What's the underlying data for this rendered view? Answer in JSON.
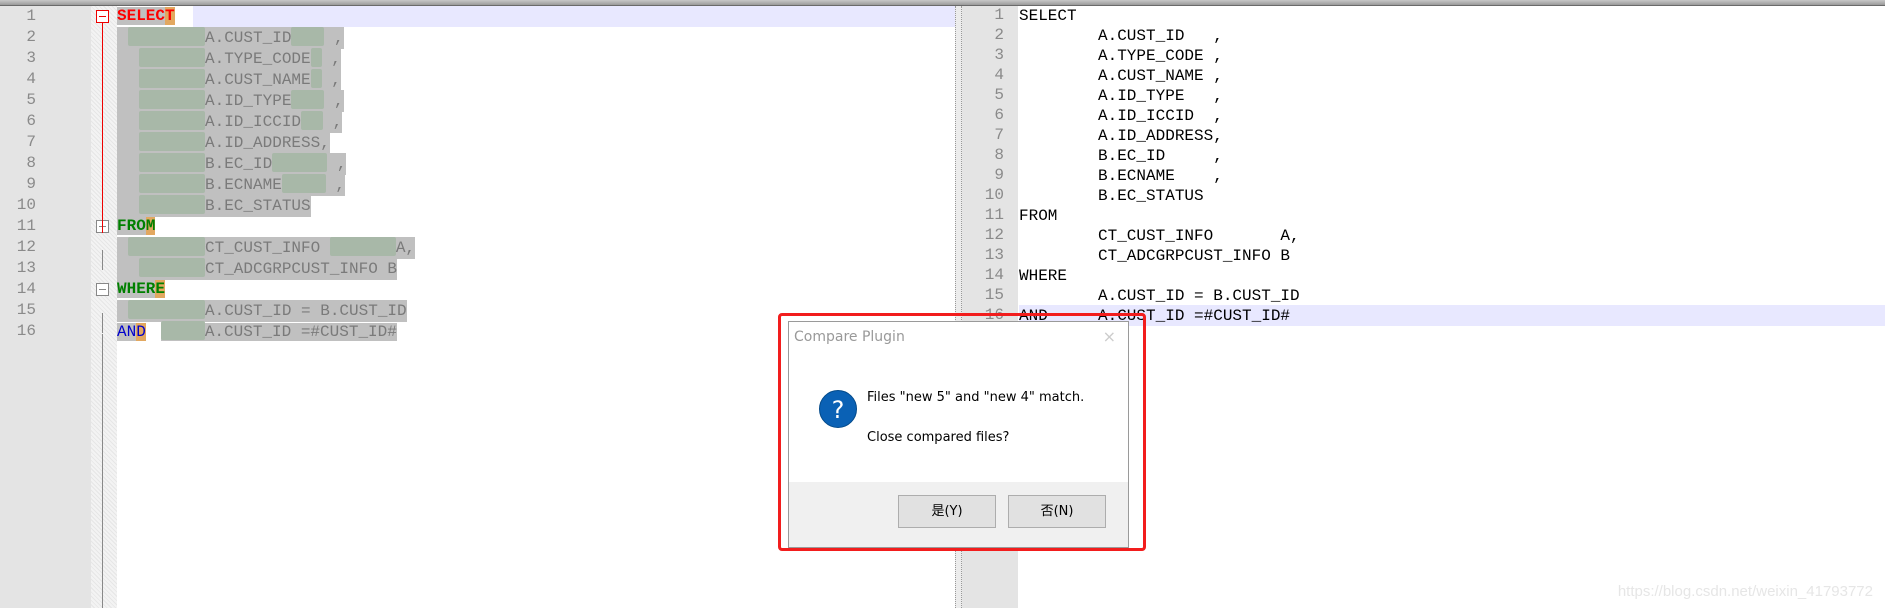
{
  "left_editor": {
    "current_line": 1,
    "lines": [
      {
        "n": "1",
        "kw": "SELECT",
        "kwclass": "kw-red",
        "text": ""
      },
      {
        "n": "2",
        "lead": [
          11,
          77
        ],
        "text": "A.CUST_ID",
        "trail": 33,
        "end": " ,"
      },
      {
        "n": "3",
        "lead": [
          22,
          66
        ],
        "text": "A.TYPE_CODE",
        "trail": 11,
        "end": " ,"
      },
      {
        "n": "4",
        "lead": [
          22,
          66
        ],
        "text": "A.CUST_NAME",
        "trail": 11,
        "end": " ,"
      },
      {
        "n": "5",
        "lead": [
          22,
          66
        ],
        "text": "A.ID_TYPE",
        "trail": 33,
        "end": " ,"
      },
      {
        "n": "6",
        "lead": [
          22,
          66
        ],
        "text": "A.ID_ICCID",
        "trail": 22,
        "end": " ,"
      },
      {
        "n": "7",
        "lead": [
          22,
          66
        ],
        "text": "A.ID_ADDRESS,",
        "trail": 0,
        "end": ""
      },
      {
        "n": "8",
        "lead": [
          22,
          66
        ],
        "text": "B.EC_ID",
        "trail": 55,
        "end": " ,"
      },
      {
        "n": "9",
        "lead": [
          22,
          66
        ],
        "text": "B.ECNAME",
        "trail": 44,
        "end": " ,"
      },
      {
        "n": "10",
        "lead": [
          22,
          66
        ],
        "text": "B.EC_STATUS",
        "trail": 0,
        "end": ""
      },
      {
        "n": "11",
        "kw": "FROM",
        "kwclass": "kw-green",
        "text": ""
      },
      {
        "n": "12",
        "lead": [
          11,
          77
        ],
        "text": "CT_CUST_INFO ",
        "trail": 66,
        "end": "A,"
      },
      {
        "n": "13",
        "lead": [
          22,
          66
        ],
        "text": "CT_ADCGRPCUST_INFO B",
        "trail": 0,
        "end": ""
      },
      {
        "n": "14",
        "kw": "WHERE",
        "kwclass": "kw-green",
        "text": ""
      },
      {
        "n": "15",
        "lead": [
          11,
          77
        ],
        "text": "A.CUST_ID = B.CUST_ID",
        "trail": 0,
        "end": ""
      },
      {
        "n": "16",
        "kw": "AND",
        "kwclass": "kw-blue",
        "lead": [
          33,
          44
        ],
        "text": "A.CUST_ID =#CUST_ID#",
        "trail": 0,
        "end": ""
      }
    ]
  },
  "right_editor": {
    "current_line": 16,
    "lines": [
      {
        "n": "1",
        "a": "SELECT",
        "b": ""
      },
      {
        "n": "2",
        "a": "",
        "b": "A.CUST_ID   ,"
      },
      {
        "n": "3",
        "a": "",
        "b": "A.TYPE_CODE ,"
      },
      {
        "n": "4",
        "a": "",
        "b": "A.CUST_NAME ,"
      },
      {
        "n": "5",
        "a": "",
        "b": "A.ID_TYPE   ,"
      },
      {
        "n": "6",
        "a": "",
        "b": "A.ID_ICCID  ,"
      },
      {
        "n": "7",
        "a": "",
        "b": "A.ID_ADDRESS,"
      },
      {
        "n": "8",
        "a": "",
        "b": "B.EC_ID     ,"
      },
      {
        "n": "9",
        "a": "",
        "b": "B.ECNAME    ,"
      },
      {
        "n": "10",
        "a": "",
        "b": "B.EC_STATUS"
      },
      {
        "n": "11",
        "a": "FROM",
        "b": ""
      },
      {
        "n": "12",
        "a": "",
        "b": "CT_CUST_INFO       A,"
      },
      {
        "n": "13",
        "a": "",
        "b": "CT_ADCGRPCUST_INFO B"
      },
      {
        "n": "14",
        "a": "WHERE",
        "b": ""
      },
      {
        "n": "15",
        "a": "",
        "b": "A.CUST_ID = B.CUST_ID"
      },
      {
        "n": "16",
        "a": "AND",
        "b": "A.CUST_ID =#CUST_ID#"
      }
    ]
  },
  "dialog": {
    "title": "Compare Plugin",
    "close_icon": "×",
    "icon": "question-icon",
    "question_glyph": "?",
    "message": "Files \"new 5\" and \"new 4\" match.",
    "question": "Close compared files?",
    "yes_label": "是(Y)",
    "no_label": "否(N)"
  },
  "colors": {
    "highlight_frame": "#f21d1d",
    "current_line": "#e8e8ff",
    "selection": "#c0c0c0",
    "keyword_select": "#ff0000",
    "keyword_from_where": "#008000",
    "keyword_and": "#0000cc"
  },
  "watermark": "https://blog.csdn.net/weixin_41793772"
}
